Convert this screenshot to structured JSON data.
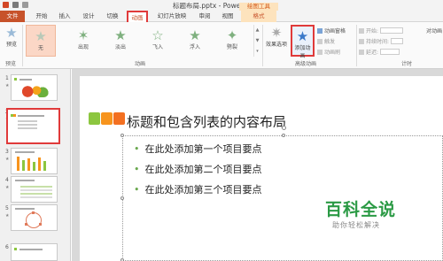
{
  "window": {
    "title": "标题布局.pptx - PowerPoint",
    "context_tab_label": "绘图工具"
  },
  "tabs": [
    "文件",
    "开始",
    "插入",
    "设计",
    "切换",
    "动画",
    "幻灯片放映",
    "审阅",
    "视图",
    "格式"
  ],
  "ribbon": {
    "preview_label": "预览",
    "preview_group": "预览",
    "animation_gallery": [
      "无",
      "出现",
      "淡出",
      "飞入",
      "浮入",
      "劈裂"
    ],
    "animation_group": "动画",
    "effect_options_label": "效果选项",
    "add_animation_label": "添加动画",
    "advanced_group": "高级动画",
    "animation_pane_label": "动画窗格",
    "trigger_label": "触发",
    "animation_painter_label": "动画刷",
    "timing": {
      "start_label": "开始:",
      "duration_label": "持续时间:",
      "delay_label": "延迟:"
    },
    "timing_group": "计时",
    "reorder_label": "对动画"
  },
  "slides_panel": {
    "numbers": [
      "1",
      "2",
      "3",
      "4",
      "5",
      "6"
    ],
    "selected_index": 2
  },
  "slide": {
    "title": "标题和包含列表的内容布局",
    "bullets": [
      "在此处添加第一个项目要点",
      "在此处添加第二个项目要点",
      "在此处添加第三个项目要点"
    ],
    "accent_colors": [
      "#8cc63f",
      "#f7941d",
      "#f37021"
    ]
  },
  "watermark": {
    "main": "百科全说",
    "sub": "助你轻松解决"
  },
  "colors": {
    "brand_ppt": "#c7522a",
    "highlight_red": "#e03a3a",
    "star_green": "#7fb07f"
  }
}
